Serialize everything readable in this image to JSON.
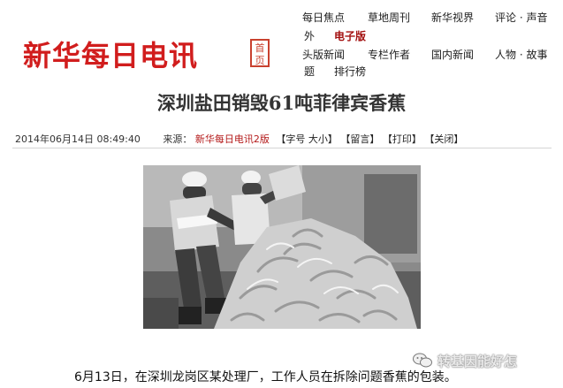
{
  "masthead": {
    "logo_text": "新华每日电讯",
    "seal_text": "首页"
  },
  "nav": {
    "row1": [
      {
        "label": "每日焦点",
        "red": false
      },
      {
        "label": "草地周刊",
        "red": false
      },
      {
        "label": "新华视界",
        "red": false
      },
      {
        "label": "评论 · 声音",
        "red": false
      }
    ],
    "row2": [
      {
        "label": "外",
        "red": false
      },
      {
        "label": "电子版",
        "red": true
      }
    ],
    "row3": [
      {
        "label": "头版新闻",
        "red": false
      },
      {
        "label": "专栏作者",
        "red": false
      },
      {
        "label": "国内新闻",
        "red": false
      },
      {
        "label": "人物 · 故事",
        "red": false
      }
    ],
    "row4": [
      {
        "label": "题",
        "red": false
      },
      {
        "label": "排行榜",
        "red": false
      }
    ]
  },
  "article": {
    "title": "深圳盐田销毁61吨菲律宾香蕉",
    "datetime": "2014年06月14日 08:49:40",
    "source_label": "来源：",
    "source": "新华每日电讯2版",
    "tools": [
      "【字号 大小】",
      "【留言】",
      "【打印】",
      "【关闭】"
    ],
    "caption": "6月13日，在深圳龙岗区某处理厂，工作人员在拆除问题香蕉的包装。"
  },
  "watermark": {
    "text": "转基因能好怎"
  }
}
